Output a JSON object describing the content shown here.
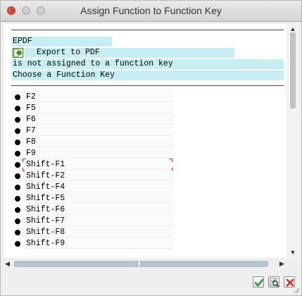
{
  "window": {
    "title": "Assign Function to Function Key"
  },
  "header_lines": {
    "function_code": "EPDF",
    "function_text": "Export to PDF",
    "message_line": "is not assigned to a function key",
    "prompt_line": "Choose a Function Key"
  },
  "keys": [
    {
      "label": "F2"
    },
    {
      "label": "F5"
    },
    {
      "label": "F6"
    },
    {
      "label": "F7"
    },
    {
      "label": "F8"
    },
    {
      "label": "F9"
    },
    {
      "label": "Shift-F1",
      "selected": true
    },
    {
      "label": "Shift-F2"
    },
    {
      "label": "Shift-F4"
    },
    {
      "label": "Shift-F5"
    },
    {
      "label": "Shift-F6"
    },
    {
      "label": "Shift-F7"
    },
    {
      "label": "Shift-F8"
    },
    {
      "label": "Shift-F9"
    }
  ],
  "icons": {
    "function": "export-arrow-icon",
    "confirm": "checkmark-icon",
    "find": "search-icon",
    "cancel": "close-x-icon"
  },
  "colors": {
    "highlight_band": "#c6eef3",
    "selection_marker": "#e03030",
    "confirm_green": "#2f9a2f",
    "cancel_red": "#d03020"
  }
}
